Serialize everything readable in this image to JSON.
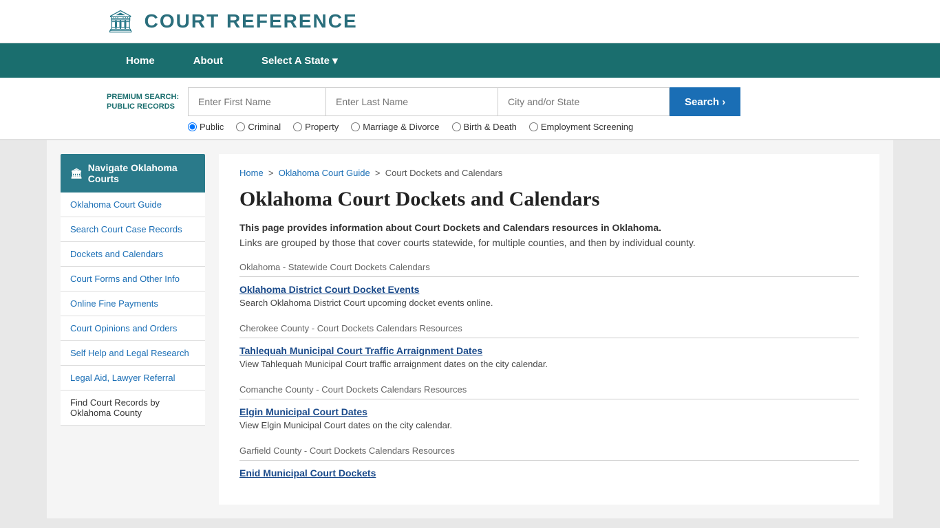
{
  "header": {
    "logo_icon": "🏛",
    "title": "COURT REFERENCE"
  },
  "nav": {
    "items": [
      {
        "label": "Home"
      },
      {
        "label": "About"
      },
      {
        "label": "Select A State ▾"
      }
    ]
  },
  "search": {
    "premium_label": "PREMIUM SEARCH: PUBLIC RECORDS",
    "first_name_placeholder": "Enter First Name",
    "last_name_placeholder": "Enter Last Name",
    "city_placeholder": "City and/or State",
    "button_label": "Search  ›",
    "radio_options": [
      "Public",
      "Criminal",
      "Property",
      "Marriage & Divorce",
      "Birth & Death",
      "Employment Screening"
    ],
    "selected_radio": "Public"
  },
  "breadcrumb": {
    "home": "Home",
    "guide": "Oklahoma Court Guide",
    "current": "Court Dockets and Calendars"
  },
  "page": {
    "title": "Oklahoma Court Dockets and Calendars",
    "intro_bold": "This page provides information about Court Dockets and Calendars resources in Oklahoma.",
    "intro_normal": "Links are grouped by those that cover courts statewide, for multiple counties, and then by individual county."
  },
  "sidebar": {
    "header_icon": "🏛",
    "header_label": "Navigate Oklahoma Courts",
    "links": [
      "Oklahoma Court Guide",
      "Search Court Case Records",
      "Dockets and Calendars",
      "Court Forms and Other Info",
      "Online Fine Payments",
      "Court Opinions and Orders",
      "Self Help and Legal Research",
      "Legal Aid, Lawyer Referral"
    ],
    "footer": "Find Court Records by Oklahoma County"
  },
  "sections": [
    {
      "header": "Oklahoma - Statewide Court Dockets Calendars",
      "resources": [
        {
          "link": "Oklahoma District Court Docket Events",
          "desc": "Search Oklahoma District Court upcoming docket events online."
        }
      ]
    },
    {
      "header": "Cherokee County - Court Dockets Calendars Resources",
      "resources": [
        {
          "link": "Tahlequah Municipal Court Traffic Arraignment Dates",
          "desc": "View Tahlequah Municipal Court traffic arraignment dates on the city calendar."
        }
      ]
    },
    {
      "header": "Comanche County - Court Dockets Calendars Resources",
      "resources": [
        {
          "link": "Elgin Municipal Court Dates",
          "desc": "View Elgin Municipal Court dates on the city calendar."
        }
      ]
    },
    {
      "header": "Garfield County - Court Dockets Calendars Resources",
      "resources": [
        {
          "link": "Enid Municipal Court Dockets",
          "desc": ""
        }
      ]
    }
  ]
}
